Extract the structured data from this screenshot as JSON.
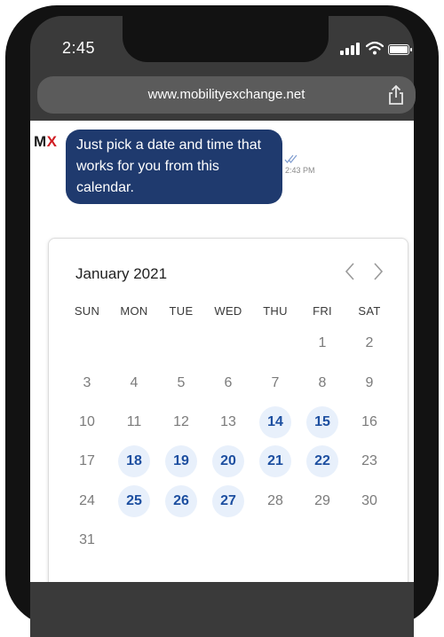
{
  "status_bar": {
    "time": "2:45"
  },
  "browser": {
    "url": "www.mobilityexchange.net"
  },
  "logo": {
    "m": "M",
    "x": "X"
  },
  "message": {
    "text": "Just pick a date and time that works for you from this calendar.",
    "time": "2:43 PM"
  },
  "calendar": {
    "month_label": "January 2021",
    "weekdays": [
      "SUN",
      "MON",
      "TUE",
      "WED",
      "THU",
      "FRI",
      "SAT"
    ],
    "days": [
      {
        "label": "1",
        "available": false
      },
      {
        "label": "2",
        "available": false
      },
      {
        "label": "3",
        "available": false
      },
      {
        "label": "4",
        "available": false
      },
      {
        "label": "5",
        "available": false
      },
      {
        "label": "6",
        "available": false
      },
      {
        "label": "7",
        "available": false
      },
      {
        "label": "8",
        "available": false
      },
      {
        "label": "9",
        "available": false
      },
      {
        "label": "10",
        "available": false
      },
      {
        "label": "11",
        "available": false
      },
      {
        "label": "12",
        "available": false
      },
      {
        "label": "13",
        "available": false
      },
      {
        "label": "14",
        "available": true
      },
      {
        "label": "15",
        "available": true
      },
      {
        "label": "16",
        "available": false
      },
      {
        "label": "17",
        "available": false
      },
      {
        "label": "18",
        "available": true
      },
      {
        "label": "19",
        "available": true
      },
      {
        "label": "20",
        "available": true
      },
      {
        "label": "21",
        "available": true
      },
      {
        "label": "22",
        "available": true
      },
      {
        "label": "23",
        "available": false
      },
      {
        "label": "24",
        "available": false
      },
      {
        "label": "25",
        "available": true
      },
      {
        "label": "26",
        "available": true
      },
      {
        "label": "27",
        "available": true
      },
      {
        "label": "28",
        "available": false
      },
      {
        "label": "29",
        "available": false
      },
      {
        "label": "30",
        "available": false
      },
      {
        "label": "31",
        "available": false
      }
    ]
  },
  "colors": {
    "bubble": "#1f3a6e",
    "available_day_bg": "#e8f0fb",
    "available_day_text": "#1d4fa0",
    "logo_x": "#d01e24"
  }
}
